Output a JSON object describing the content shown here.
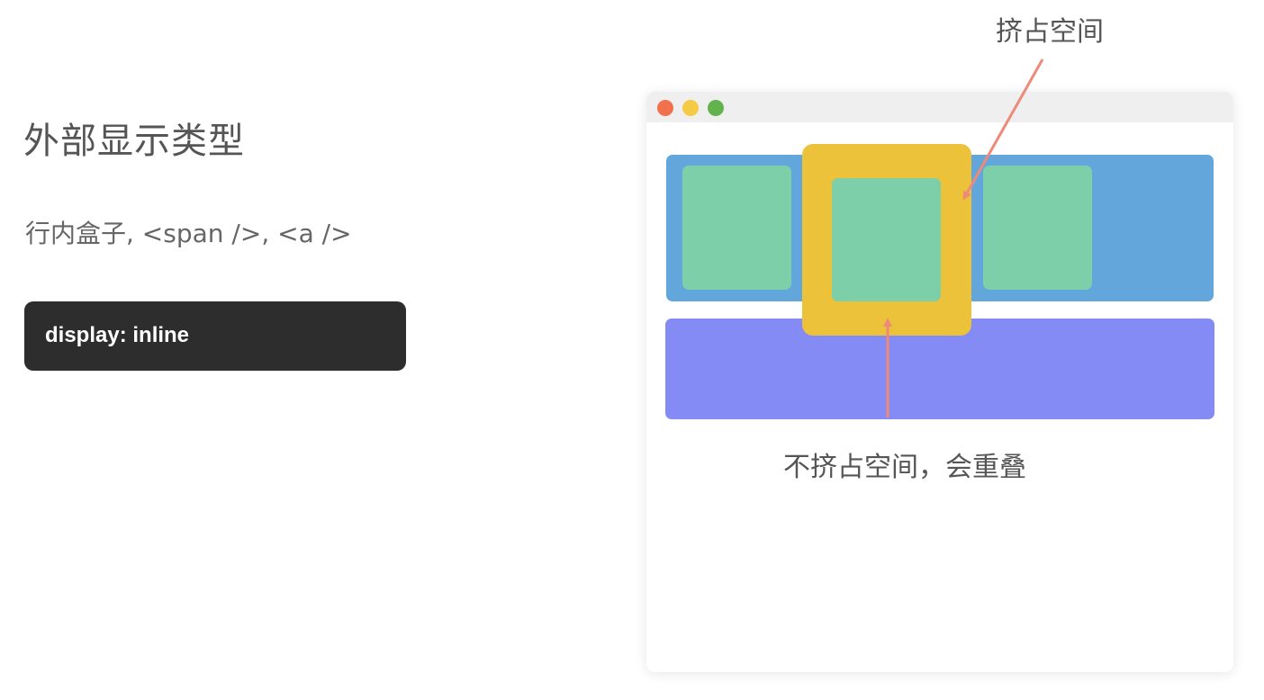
{
  "left_panel": {
    "title": "外部显示类型",
    "subtitle": "行内盒子, <span />, <a />",
    "code": "display: inline"
  },
  "diagram": {
    "caption_top": "挤占空间",
    "caption_bottom": "不挤占空间，会重叠",
    "colors": {
      "blue_box": "#62a6dc",
      "purple_box": "#858bf4",
      "green_box": "#7ccfa8",
      "yellow_box": "#ecc23a",
      "arrow": "#ee8a78",
      "window_dot_red": "#f0714c",
      "window_dot_yellow": "#f5ca44",
      "window_dot_green": "#62b34d"
    }
  }
}
